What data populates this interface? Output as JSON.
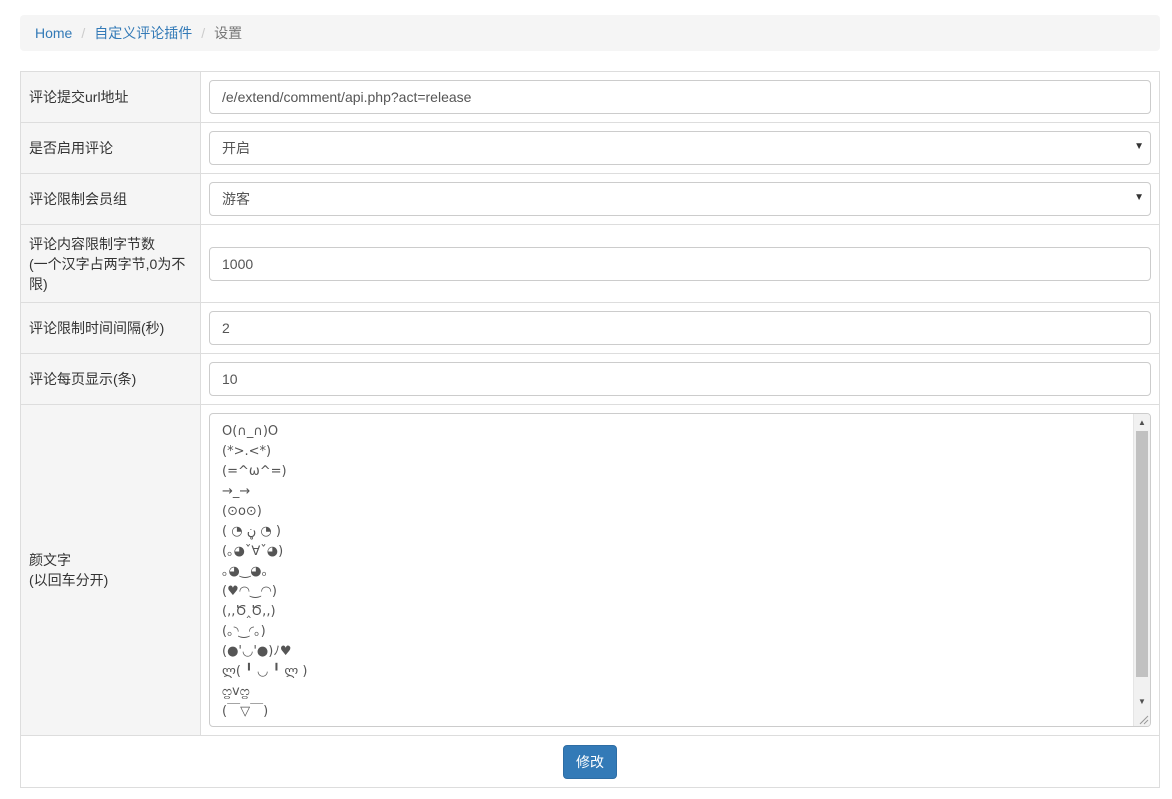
{
  "breadcrumb": {
    "home": "Home",
    "plugin": "自定义评论插件",
    "current": "设置",
    "separator": "/"
  },
  "form": {
    "rows": [
      {
        "label": "评论提交url地址",
        "value": "/e/extend/comment/api.php?act=release"
      },
      {
        "label": "是否启用评论",
        "value": "开启"
      },
      {
        "label": "评论限制会员组",
        "value": "游客"
      },
      {
        "label_line1": "评论内容限制字节数",
        "label_line2": "(一个汉字占两字节,0为不",
        "label_line3": "限)",
        "value": "1000"
      },
      {
        "label": "评论限制时间间隔(秒)",
        "value": "2"
      },
      {
        "label": "评论每页显示(条)",
        "value": "10"
      },
      {
        "label_line1": "颜文字",
        "label_line2": "(以回车分开)"
      }
    ],
    "emoticons": [
      "O(∩_∩)O",
      "(*>.<*)",
      "(=^ω^=)",
      "→_→",
      "(⊙o⊙)",
      "( ◔ ڼ ◔ )",
      "(｡◕ˇ∀ˇ◕)",
      "｡◕‿◕｡",
      "(♥◠‿◠)",
      "(,,Ծ‸Ծ,,)",
      "(｡◝‿◜｡)",
      "(●'◡'●)ﾉ♥",
      "ლ( ╹ ◡ ╹ ლ )",
      "ᦦvᦦ",
      "(￣▽￣)"
    ],
    "submit_label": "修改"
  }
}
